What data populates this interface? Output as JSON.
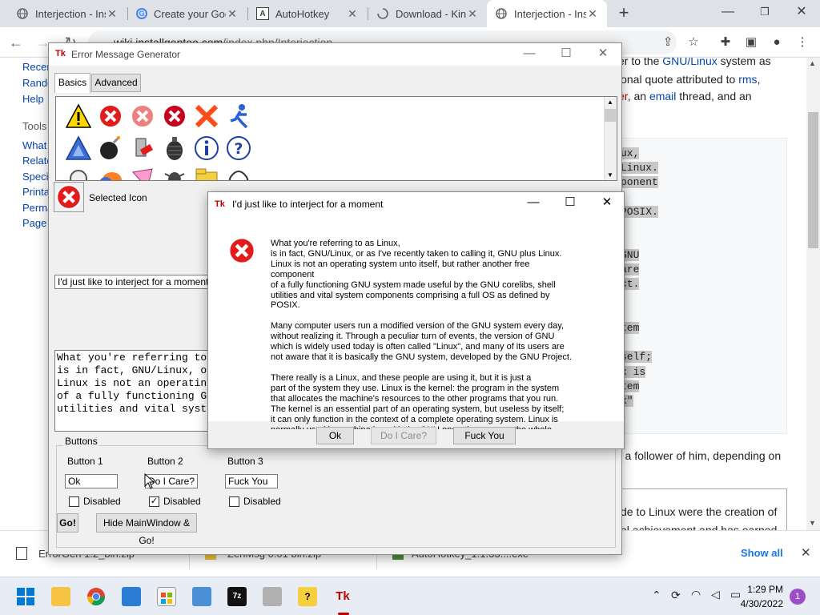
{
  "browser": {
    "tabs": [
      {
        "label": "Interjection - Ins"
      },
      {
        "label": "Create your Goo"
      },
      {
        "label": "AutoHotkey"
      },
      {
        "label": "Download - Kins"
      },
      {
        "label": "Interjection - Ins"
      }
    ],
    "url_host": "wiki.installgentoo.com",
    "url_path": "/index.php/Interjection"
  },
  "wiki": {
    "sidebar_links": [
      "Recen",
      "Rando",
      "Help"
    ],
    "tools_heading": "Tools",
    "tools_links": [
      "What l",
      "Relate",
      "Specia",
      "Printa",
      "Perma",
      "Page i"
    ],
    "line1_pre": "er to the ",
    "line1_link": "GNU/Linux",
    "line1_post": " system as",
    "line2_pre": "ional quote attributed to ",
    "line2_link": "rms",
    "line2_post": ",",
    "line3_link1": "er",
    "line3_mid": ", an ",
    "line3_link2": "email",
    "line3_post": " thread, and an",
    "code_lines": [
      "ux,",
      "Linux.",
      "ponent",
      "POSIX.",
      "GNU",
      "are",
      "ct.",
      "tem",
      "self;",
      "x is",
      "tem",
      "x\""
    ],
    "follower": "r a follower of him, depending on",
    "bottom1": "de to Linux were the creation of",
    "bottom2": "al achievement and has earned"
  },
  "downloads": {
    "items": [
      "ErrorGen 1.2_bin.zip",
      "ZenMsg 0.01 bin.zip",
      "AutoHotkey_1.1.33....exe"
    ],
    "show_all": "Show all"
  },
  "taskbar": {
    "time": "1:29 PM",
    "date": "4/30/2022",
    "notifications": "1"
  },
  "errgen": {
    "title": "Error Message Generator",
    "tabs": [
      "Basics",
      "Advanced"
    ],
    "selected_icon_label": "Selected Icon",
    "title_field": "I'd just like to interject for a moment",
    "message_preview": "What you're referring to\nis in fact, GNU/Linux, o\nLinux is not an operatin\nof a fully functioning G\nutilities and vital syst",
    "buttons_group": "Buttons",
    "button_labels": [
      "Button 1",
      "Button 2",
      "Button 3"
    ],
    "button_values": [
      "Ok",
      "Do I Care?",
      "Fuck You"
    ],
    "disabled_label": "Disabled",
    "disabled_checked": [
      false,
      true,
      false
    ],
    "go": "Go!",
    "hide_go": "Hide MainWindow & Go!"
  },
  "dialog": {
    "title": "I'd just like to interject for a moment",
    "paragraphs": [
      "What you're referring to as Linux,\nis in fact, GNU/Linux, or as I've recently taken to calling it, GNU plus Linux.\nLinux is not an operating system unto itself, but rather another free component\nof a fully functioning GNU system made useful by the GNU corelibs, shell\nutilities and vital system components comprising a full OS as defined by POSIX.",
      "Many computer users run a modified version of the GNU system every day,\nwithout realizing it.  Through a peculiar turn of events, the version of GNU\nwhich is widely used today is often called \"Linux\", and many of its users are\nnot aware that it is basically the GNU system, developed by the GNU Project.",
      "There really is a Linux, and these people are using it, but it is just a\npart of the system they use.  Linux is the kernel: the program in the system\nthat allocates the machine's resources to the other programs that you run.\nThe kernel is an essential part of an operating system, but useless by itself;\nit can only function in the context of a complete operating system.  Linux is\nnormally used in combination with the GNU operating system: the whole system\nis basically GNU with Linux added, or GNU/Linux.  All the so-called \"Linux\"\ndistributions"
    ],
    "buttons": [
      "Ok",
      "Do I Care?",
      "Fuck You"
    ]
  },
  "colors": {
    "error_red": "#e21b1b",
    "link_blue": "#0645ad",
    "visited_red": "#ba0000"
  }
}
